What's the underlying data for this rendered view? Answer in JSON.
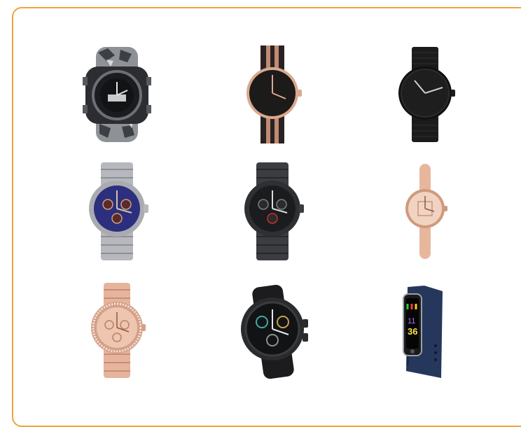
{
  "colors": {
    "panel_border": "#f0a53a",
    "background": "#ffffff"
  },
  "products": [
    {
      "name": "camouflage-sport-watch",
      "icon": "watch-icon"
    },
    {
      "name": "rose-gold-striped-strap-watch",
      "icon": "watch-icon"
    },
    {
      "name": "black-mesh-watch",
      "icon": "watch-icon"
    },
    {
      "name": "silver-blue-chronograph-watch",
      "icon": "watch-icon"
    },
    {
      "name": "gunmetal-chronograph-watch",
      "icon": "watch-icon"
    },
    {
      "name": "ladies-nude-strap-watch",
      "icon": "watch-icon"
    },
    {
      "name": "rose-gold-crystal-watch",
      "icon": "watch-icon"
    },
    {
      "name": "black-smartwatch",
      "icon": "smartwatch-icon"
    },
    {
      "name": "blue-fitness-band",
      "icon": "fitness-band-icon"
    }
  ],
  "fitness_band": {
    "time_hours": "11",
    "time_minutes": "36"
  }
}
